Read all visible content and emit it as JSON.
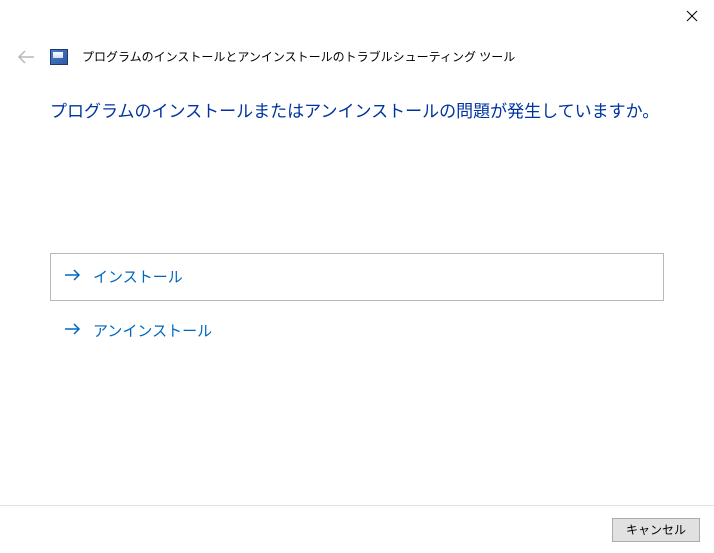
{
  "window": {
    "title": "プログラムのインストールとアンインストールのトラブルシューティング ツール"
  },
  "main": {
    "heading": "プログラムのインストールまたはアンインストールの問題が発生していますか。",
    "options": [
      {
        "label": "インストール"
      },
      {
        "label": "アンインストール"
      }
    ]
  },
  "footer": {
    "cancel_label": "キャンセル"
  }
}
